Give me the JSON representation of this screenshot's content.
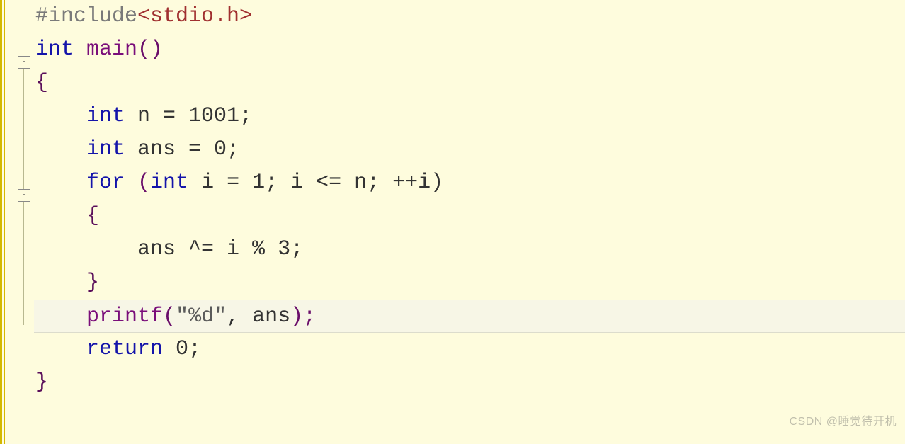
{
  "code": {
    "line1_include": "#include",
    "line1_path": "<stdio.h>",
    "line2_type": "int",
    "line2_func": " main",
    "line2_paren": "()",
    "line3_brace": "{",
    "line4_indent": "    ",
    "line4_type": "int",
    "line4_rest": " n = 1001;",
    "line5_indent": "    ",
    "line5_type": "int",
    "line5_rest": " ans = 0;",
    "line6_indent": "    ",
    "line6_for": "for",
    "line6_paren1": " (",
    "line6_type": "int",
    "line6_rest": " i = 1; i <= n; ++i)",
    "line7_indent": "    ",
    "line7_brace": "{",
    "line8_indent": "        ",
    "line8_rest": "ans ^= i % 3;",
    "line9_indent": "    ",
    "line9_brace": "}",
    "line10_indent": "    ",
    "line10_func": "printf",
    "line10_paren1": "(",
    "line10_str": "\"%d\"",
    "line10_rest": ", ans",
    "line10_paren2": ");",
    "line11_indent": "    ",
    "line11_return": "return",
    "line11_rest": " 0;",
    "line12_brace": "}"
  },
  "fold": {
    "minus1": "-",
    "minus2": "-"
  },
  "watermark": "CSDN @睡觉待开机"
}
